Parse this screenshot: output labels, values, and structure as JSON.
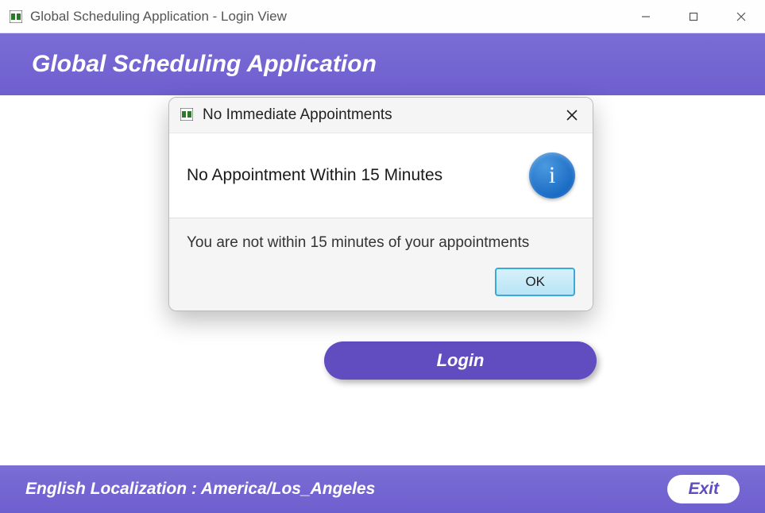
{
  "window": {
    "title": "Global Scheduling Application - Login View"
  },
  "header": {
    "title": "Global Scheduling Application"
  },
  "login": {
    "button_label": "Login"
  },
  "footer": {
    "localization_text": "English Localization : America/Los_Angeles",
    "exit_label": "Exit"
  },
  "dialog": {
    "title": "No Immediate Appointments",
    "heading": "No Appointment Within 15 Minutes",
    "message": "You are not within 15 minutes of your appointments",
    "ok_label": "OK",
    "info_letter": "i"
  }
}
